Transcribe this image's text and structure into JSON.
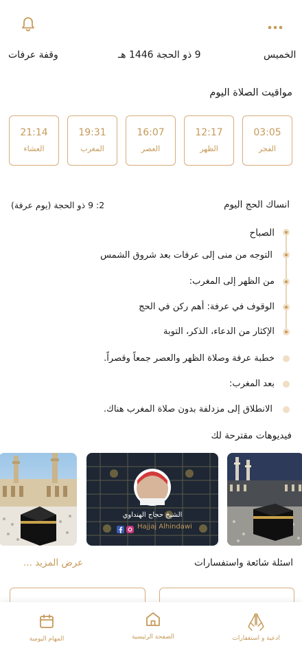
{
  "header": {
    "day": "الخميس",
    "hijri_date": "9 ذو الحجة 1446 هـ",
    "occasion": "وقفة عرفات"
  },
  "prayer_section": {
    "title": "مواقيت الصلاة اليوم",
    "prayers": [
      {
        "name": "الفجر",
        "time": "03:05"
      },
      {
        "name": "الظهر",
        "time": "12:17"
      },
      {
        "name": "العصر",
        "time": "16:07"
      },
      {
        "name": "المغرب",
        "time": "19:31"
      },
      {
        "name": "العشاء",
        "time": "21:14"
      }
    ]
  },
  "hajj_section": {
    "title": "انساك الحج اليوم",
    "day_label": "2: 9 ذو الحجة (يوم عرفة)",
    "items": [
      "الصباح",
      "التوجه من منى إلى عرفات بعد شروق الشمس",
      "من الظهر إلى المغرب:",
      "الوقوف في عرفة: أهم ركن في الحج",
      "الإكثار من الدعاء، الذكر، التوبة",
      "خطبة عرفة وصلاة الظهر والعصر جمعاً وقصراً.",
      "بعد المغرب:",
      "الانطلاق إلى مزدلفة بدون صلاة المغرب هناك."
    ]
  },
  "videos_section": {
    "title": "فيديوهات مقترحة لك",
    "featured_name": "الشيخ حجاج الهنداوي",
    "featured_handle": "Hajjaj Alhindawi"
  },
  "faq_section": {
    "title": "اسئلة شائعة واستفسارات",
    "more_label": "عرض المزيد ..."
  },
  "bottom_nav": {
    "duas": "ادعية و استغفارات",
    "home": "الصفحة الرئيسية",
    "tasks": "المهام اليومية"
  },
  "colors": {
    "accent": "#c59a59",
    "card_border": "#d6ad7b",
    "timeline": "#e8d3b4"
  }
}
